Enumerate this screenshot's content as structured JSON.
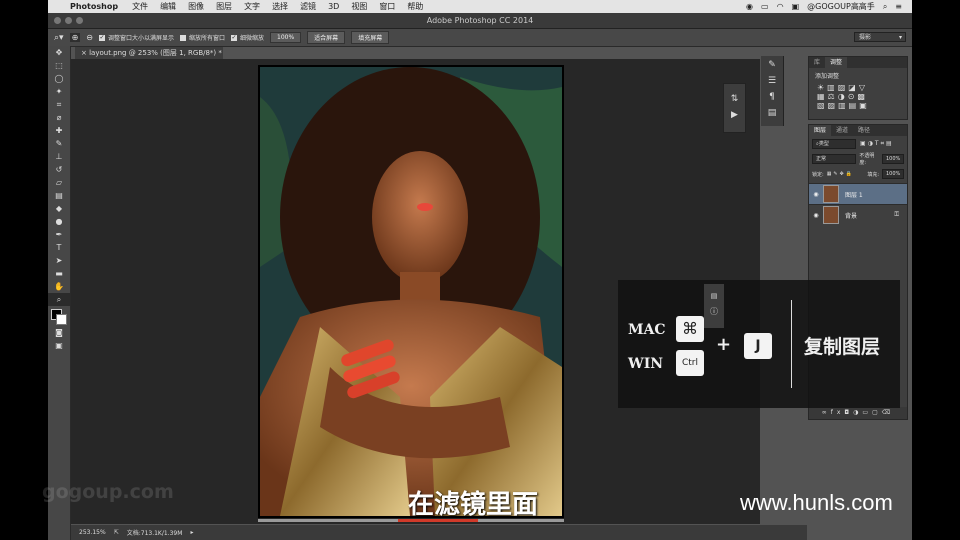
{
  "menubar": {
    "app_name": "Photoshop",
    "items": [
      "文件",
      "编辑",
      "图像",
      "图层",
      "文字",
      "选择",
      "滤镜",
      "3D",
      "视图",
      "窗口",
      "帮助"
    ],
    "user": "@GOGOUP高高手"
  },
  "window": {
    "title": "Adobe Photoshop CC 2014"
  },
  "options_bar": {
    "check_resize": "调整窗口大小以满屏显示",
    "check_zoom_all": "缩放所有窗口",
    "check_scrubby": "细微缩放",
    "btn_100": "100%",
    "btn_fit": "适合屏幕",
    "btn_fill": "填充屏幕",
    "workspace": "摄影"
  },
  "document": {
    "tab_label": "layout.png @ 253% (图层 1, RGB/8*) *",
    "zoom": "253.15%",
    "doc_info": "文档:713.1K/1.39M"
  },
  "adjustments_panel": {
    "tabs": [
      "库",
      "调整"
    ],
    "heading": "添加调整"
  },
  "layers_panel": {
    "tabs": [
      "图层",
      "通道",
      "路径"
    ],
    "filter_kind": "类型",
    "blend_mode": "正常",
    "opacity_label": "不透明度:",
    "opacity_value": "100%",
    "lock_label": "锁定:",
    "fill_label": "填充:",
    "fill_value": "100%",
    "layers": [
      {
        "name": "图层 1"
      },
      {
        "name": "背景"
      }
    ]
  },
  "overlay": {
    "mac_label": "MAC",
    "win_label": "WIN",
    "mac_key": "⌘",
    "win_key": "Ctrl",
    "plus": "+",
    "key": "J",
    "action": "复制图层"
  },
  "caption": "在滤镜里面",
  "watermark_site": "www.hunls.com",
  "watermark_brand": "gogoup.com",
  "colors": {
    "accent_layer": "#5c6f86",
    "caption_bar": "#d13a2a"
  }
}
